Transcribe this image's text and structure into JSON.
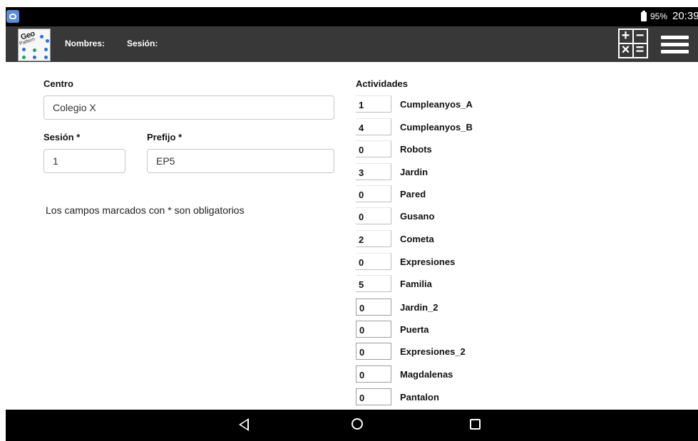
{
  "status_bar": {
    "battery_percent": "95%",
    "time": "20:39",
    "app_icon": "app-notification-icon",
    "battery_icon": "battery-icon"
  },
  "header": {
    "logo_text": "Geo",
    "logo_subtext": "Pattern",
    "nombres_label": "Nombres:",
    "sesion_label": "Sesión:",
    "calculator_symbols": [
      "+",
      "−",
      "×",
      "="
    ],
    "background_color": "#383838"
  },
  "form": {
    "centro_label": "Centro",
    "centro_value": "Colegio X",
    "sesion_label": "Sesión *",
    "sesion_value": "1",
    "prefijo_label": "Prefijo *",
    "prefijo_value": "EP5",
    "required_note": "Los campos marcados con * son obligatorios"
  },
  "activities": {
    "title": "Actividades",
    "items": [
      {
        "count": "1",
        "name": "Cumpleanyos_A"
      },
      {
        "count": "4",
        "name": "Cumpleanyos_B"
      },
      {
        "count": "0",
        "name": "Robots"
      },
      {
        "count": "3",
        "name": "Jardin"
      },
      {
        "count": "0",
        "name": "Pared"
      },
      {
        "count": "0",
        "name": "Gusano"
      },
      {
        "count": "2",
        "name": "Cometa"
      },
      {
        "count": "0",
        "name": "Expresiones"
      },
      {
        "count": "5",
        "name": "Familia"
      },
      {
        "count": "0",
        "name": "Jardin_2"
      },
      {
        "count": "0",
        "name": "Puerta"
      },
      {
        "count": "0",
        "name": "Expresiones_2"
      },
      {
        "count": "0",
        "name": "Magdalenas"
      },
      {
        "count": "0",
        "name": "Pantalon"
      }
    ]
  },
  "nav_bar": {
    "back_icon": "back-triangle-icon",
    "home_icon": "home-circle-icon",
    "recent_icon": "recent-apps-square-icon"
  }
}
